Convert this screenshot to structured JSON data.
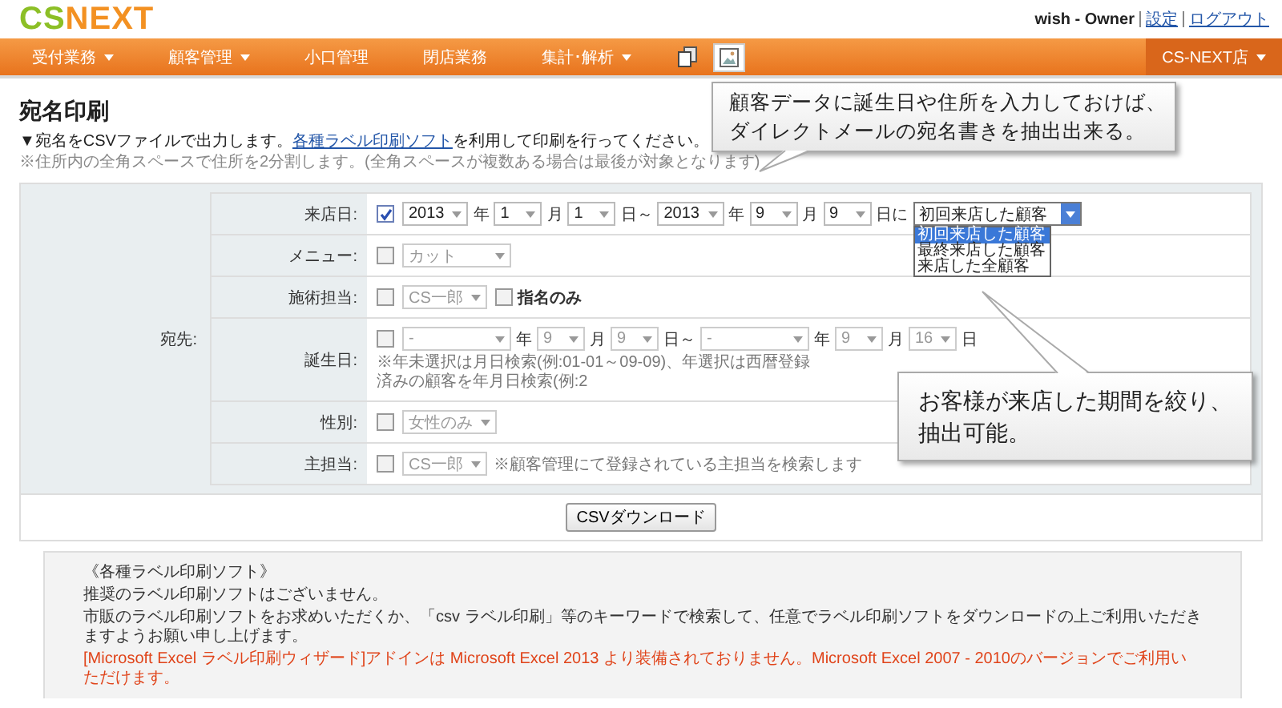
{
  "header": {
    "logo": [
      "CS",
      "NEXT"
    ],
    "user": "wish - Owner",
    "links": [
      "設定",
      "ログアウト"
    ]
  },
  "nav": {
    "items": [
      {
        "label": "受付業務",
        "dropdown": true
      },
      {
        "label": "顧客管理",
        "dropdown": true
      },
      {
        "label": "小口管理",
        "dropdown": false
      },
      {
        "label": "閉店業務",
        "dropdown": false
      },
      {
        "label": "集計･解析",
        "dropdown": true
      }
    ],
    "icons": [
      {
        "kind": "pages",
        "selected": false
      },
      {
        "kind": "picture",
        "selected": true
      }
    ],
    "store": {
      "label": "CS-NEXT店",
      "dropdown": true
    }
  },
  "title": "宛名印刷",
  "intro": {
    "before": "▼宛名をCSVファイルで出力します。",
    "link": "各種ラベル印刷ソフト",
    "after": "を利用して印刷を行ってください。"
  },
  "note": "※住所内の全角スペースで住所を2分割します。(全角スペースが複数ある場合は最後が対象となります)",
  "form": {
    "group_label": "宛先:",
    "rows": [
      {
        "label": "来店日:",
        "checked": true,
        "parts": [
          {
            "kind": "select",
            "value": "2013",
            "disabled": false,
            "open": false
          },
          {
            "kind": "text",
            "text": "年"
          },
          {
            "kind": "select",
            "value": "1",
            "disabled": false,
            "open": false
          },
          {
            "kind": "text",
            "text": "月"
          },
          {
            "kind": "select",
            "value": "1",
            "disabled": false,
            "open": false
          },
          {
            "kind": "text",
            "text": "日～"
          },
          {
            "kind": "select",
            "value": "2013",
            "disabled": false,
            "open": false
          },
          {
            "kind": "text",
            "text": "年"
          },
          {
            "kind": "select",
            "value": "9",
            "disabled": false,
            "open": false
          },
          {
            "kind": "text",
            "text": "月"
          },
          {
            "kind": "select",
            "value": "9",
            "disabled": false,
            "open": false
          },
          {
            "kind": "text",
            "text": "日に"
          },
          {
            "kind": "select",
            "value": "初回来店した顧客",
            "disabled": false,
            "open": true,
            "options": [
              {
                "label": "初回来店した顧客",
                "selected": true
              },
              {
                "label": "最終来店した顧客",
                "selected": false
              },
              {
                "label": "来店した全顧客",
                "selected": false
              }
            ]
          }
        ]
      },
      {
        "label": "メニュー:",
        "checked": false,
        "parts": [
          {
            "kind": "select",
            "value": "カット",
            "disabled": true,
            "open": false,
            "wide": true
          }
        ]
      },
      {
        "label": "施術担当:",
        "checked": false,
        "parts": [
          {
            "kind": "select",
            "value": "CS一郎",
            "disabled": true,
            "open": false
          },
          {
            "kind": "checkbox",
            "label": "指名のみ",
            "checked": false
          }
        ]
      },
      {
        "label": "誕生日:",
        "checked": false,
        "parts": [
          {
            "kind": "select",
            "value": "-",
            "disabled": true,
            "open": false,
            "wide": true
          },
          {
            "kind": "text",
            "text": "年"
          },
          {
            "kind": "select",
            "value": "9",
            "disabled": true,
            "open": false
          },
          {
            "kind": "text",
            "text": "月"
          },
          {
            "kind": "select",
            "value": "9",
            "disabled": true,
            "open": false
          },
          {
            "kind": "text",
            "text": "日～"
          },
          {
            "kind": "select",
            "value": "-",
            "disabled": true,
            "open": false,
            "wide": true
          },
          {
            "kind": "text",
            "text": "年"
          },
          {
            "kind": "select",
            "value": "9",
            "disabled": true,
            "open": false
          },
          {
            "kind": "text",
            "text": "月"
          },
          {
            "kind": "select",
            "value": "16",
            "disabled": true,
            "open": false
          },
          {
            "kind": "text",
            "text": "日"
          }
        ],
        "hint": "※年未選択は月日検索(例:01-01～09-09)、年選択は西暦登録済みの顧客を年月日検索(例:2"
      },
      {
        "label": "性別:",
        "checked": false,
        "parts": [
          {
            "kind": "select",
            "value": "女性のみ",
            "disabled": true,
            "open": false
          }
        ]
      },
      {
        "label": "主担当:",
        "checked": false,
        "parts": [
          {
            "kind": "select",
            "value": "CS一郎",
            "disabled": true,
            "open": false
          },
          {
            "kind": "note",
            "text": "※顧客管理にて登録されている主担当を検索します"
          }
        ]
      }
    ],
    "button": "CSVダウンロード"
  },
  "info": [
    {
      "kind": "normal",
      "text": "《各種ラベル印刷ソフト》"
    },
    {
      "kind": "normal",
      "text": "推奨のラベル印刷ソフトはございません。"
    },
    {
      "kind": "normal",
      "text": "市販のラベル印刷ソフトをお求めいただくか、「csv ラベル印刷」等のキーワードで検索して、任意でラベル印刷ソフトをダウンロードの上ご利用いただきますようお願い申し上げます。"
    },
    {
      "kind": "warning",
      "text": "[Microsoft Excel ラベル印刷ウィザード]アドインは Microsoft Excel 2013 より装備されておりません。Microsoft Excel 2007 - 2010のバージョンでご利用いただけます。"
    }
  ],
  "callouts": [
    {
      "kind": "below",
      "lines": [
        "顧客データに誕生日や住所を入力しておけば、",
        "ダイレクトメールの宛名書きを抽出出来る。"
      ]
    },
    {
      "kind": "above",
      "lines": [
        "お客様が来店した期間を絞り、",
        "抽出可能。"
      ]
    }
  ]
}
